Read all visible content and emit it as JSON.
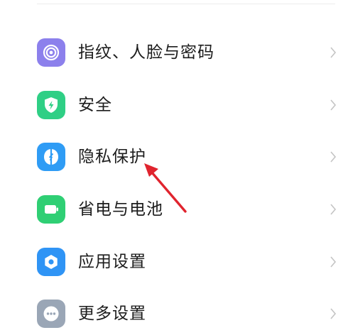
{
  "settings": {
    "items": [
      {
        "label": "指纹、人脸与密码",
        "icon": "fingerprint-icon",
        "color": "#8c80ec"
      },
      {
        "label": "安全",
        "icon": "shield-icon",
        "color": "#2fcf85"
      },
      {
        "label": "隐私保护",
        "icon": "privacy-icon",
        "color": "#2f9cf5"
      },
      {
        "label": "省电与电池",
        "icon": "battery-icon",
        "color": "#2fcf74"
      },
      {
        "label": "应用设置",
        "icon": "gear-icon",
        "color": "#2f94f5"
      },
      {
        "label": "更多设置",
        "icon": "more-icon",
        "color": "#9aa6b6"
      }
    ]
  },
  "annotation": {
    "type": "red-arrow",
    "target": "隐私保护",
    "color": "#e0242e"
  }
}
